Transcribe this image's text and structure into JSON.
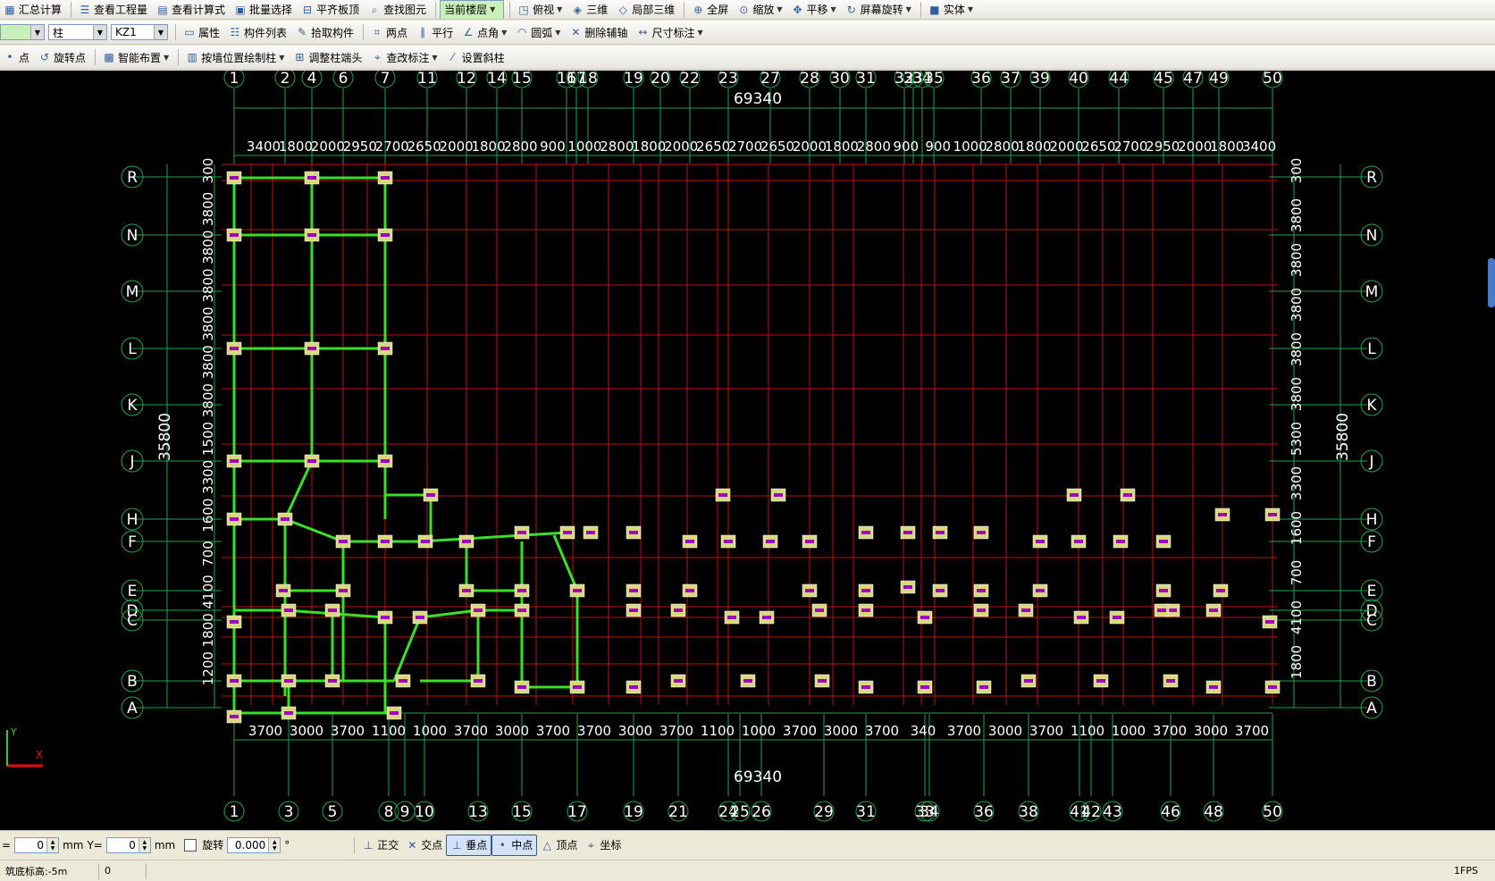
{
  "toolbar1": [
    {
      "label": "汇总计算",
      "icon": "calculator-icon",
      "dd": false
    },
    {
      "label": "查看工程量",
      "icon": "view-quantity-icon",
      "dd": false
    },
    {
      "label": "查看计算式",
      "icon": "view-formula-icon",
      "dd": false
    },
    {
      "label": "批量选择",
      "icon": "batch-select-icon",
      "dd": false
    },
    {
      "label": "平齐板顶",
      "icon": "align-slab-icon",
      "dd": false
    },
    {
      "label": "查找图元",
      "icon": "find-element-icon",
      "dd": false
    },
    {
      "label": "当前楼层",
      "icon": "",
      "dd": true,
      "combo": true
    },
    {
      "label": "俯视",
      "icon": "top-view-icon",
      "dd": true
    },
    {
      "label": "三维",
      "icon": "3d-icon",
      "dd": false
    },
    {
      "label": "局部三维",
      "icon": "local-3d-icon",
      "dd": false
    },
    {
      "label": "全屏",
      "icon": "fullscreen-icon",
      "dd": false
    },
    {
      "label": "缩放",
      "icon": "zoom-icon",
      "dd": true
    },
    {
      "label": "平移",
      "icon": "pan-icon",
      "dd": true
    },
    {
      "label": "屏幕旋转",
      "icon": "rotate-screen-icon",
      "dd": true
    },
    {
      "label": "实体",
      "icon": "solid-icon",
      "dd": true
    }
  ],
  "toolbar2": {
    "combo1": "",
    "combo2": "柱",
    "combo3": "KZ1",
    "items": [
      {
        "label": "属性",
        "icon": "properties-icon",
        "dd": false
      },
      {
        "label": "构件列表",
        "icon": "component-list-icon",
        "dd": false
      },
      {
        "label": "拾取构件",
        "icon": "pick-component-icon",
        "dd": false
      },
      {
        "label": "两点",
        "icon": "two-point-icon",
        "dd": false
      },
      {
        "label": "平行",
        "icon": "parallel-icon",
        "dd": false
      },
      {
        "label": "点角",
        "icon": "point-angle-icon",
        "dd": true
      },
      {
        "label": "圆弧",
        "icon": "arc-icon",
        "dd": true
      },
      {
        "label": "删除辅轴",
        "icon": "delete-aux-axis-icon",
        "dd": false
      },
      {
        "label": "尺寸标注",
        "icon": "dimension-icon",
        "dd": true
      }
    ]
  },
  "toolbar3": [
    {
      "label": "点",
      "icon": "point-icon",
      "dd": false
    },
    {
      "label": "旋转点",
      "icon": "rotate-point-icon",
      "dd": false
    },
    {
      "label": "智能布置",
      "icon": "smart-layout-icon",
      "dd": true
    },
    {
      "label": "按墙位置绘制柱",
      "icon": "wall-column-icon",
      "dd": true
    },
    {
      "label": "调整柱端头",
      "icon": "adjust-column-icon",
      "dd": false
    },
    {
      "label": "查改标注",
      "icon": "edit-label-icon",
      "dd": true
    },
    {
      "label": "设置斜柱",
      "icon": "slant-column-icon",
      "dd": false
    }
  ],
  "status": {
    "x_label": "=",
    "x_value": "0",
    "mm1": "mm",
    "y_label": "Y=",
    "y_value": "0",
    "mm2": "mm",
    "rotate_label": "旋转",
    "rotate_value": "0.000",
    "degree": "°",
    "snaps": [
      {
        "label": "正交",
        "icon": "ortho-icon",
        "on": false
      },
      {
        "label": "交点",
        "icon": "intersection-icon",
        "on": false
      },
      {
        "label": "垂点",
        "icon": "perpendicular-icon",
        "on": true
      },
      {
        "label": "中点",
        "icon": "midpoint-icon",
        "on": true
      },
      {
        "label": "顶点",
        "icon": "vertex-icon",
        "on": false
      },
      {
        "label": "坐标",
        "icon": "coordinate-icon",
        "on": false
      }
    ]
  },
  "bottom": {
    "elevation": "筑底标高:-5m",
    "value": "0",
    "fps": "1FPS"
  },
  "drawing": {
    "colors": {
      "bg": "#000000",
      "axis": "#1fa34a",
      "aux": "#c01010",
      "beam": "#38e028",
      "column_fill": "#d8d880",
      "column_core": "#a000c0",
      "text": "#ffffff"
    },
    "top_labels": [
      "1",
      "2",
      "4",
      "6",
      "7",
      "11",
      "12",
      "14",
      "15",
      "16",
      "17",
      "18",
      "19",
      "20",
      "22",
      "23",
      "27",
      "28",
      "30",
      "31",
      "32",
      "33",
      "34",
      "35",
      "36",
      "37",
      "39",
      "40",
      "44",
      "45",
      "47",
      "49",
      "50"
    ],
    "bottom_labels": [
      "1",
      "3",
      "5",
      "8",
      "9",
      "10",
      "13",
      "15",
      "17",
      "19",
      "21",
      "24",
      "25",
      "26",
      "29",
      "31",
      "33",
      "34",
      "36",
      "38",
      "41",
      "42",
      "43",
      "46",
      "48",
      "50"
    ],
    "row_labels": [
      "R",
      "N",
      "M",
      "L",
      "K",
      "J",
      "H",
      "F",
      "E",
      "D",
      "C",
      "B",
      "A"
    ],
    "total_top": "69340",
    "total_bottom": "69340",
    "total_left": "35800",
    "total_right": "35800",
    "top_dims": [
      "3400",
      "1800",
      "2000",
      "2950",
      "2700",
      "2650",
      "2000",
      "1800",
      "2800",
      "900",
      "1000",
      "2800",
      "1800",
      "2000",
      "2650",
      "2700",
      "2650",
      "2000",
      "1800",
      "2800",
      "900",
      "900",
      "1000",
      "2800",
      "1800",
      "2000",
      "2650",
      "2700",
      "2950",
      "2000",
      "1800",
      "3400"
    ],
    "bottom_dims": [
      "3700",
      "3000",
      "3700",
      "1100",
      "1000",
      "3700",
      "3000",
      "3700",
      "3700",
      "3000",
      "3700",
      "1100",
      "1000",
      "3700",
      "3000",
      "3700",
      "340",
      "3700",
      "3000",
      "3700",
      "1100",
      "1000",
      "3700",
      "3000",
      "3700"
    ],
    "left_dims": [
      "300",
      "3800",
      "3800",
      "3800",
      "3800",
      "3800",
      "3800",
      "1500",
      "3300",
      "1600",
      "700",
      "4100",
      "1800",
      "1200"
    ],
    "right_dims": [
      "300",
      "3800",
      "3800",
      "3800",
      "3800",
      "3800",
      "5300",
      "3300",
      "1600",
      "700",
      "4100",
      "1800"
    ],
    "axes_label": {
      "x": "X",
      "y": "Y"
    }
  }
}
